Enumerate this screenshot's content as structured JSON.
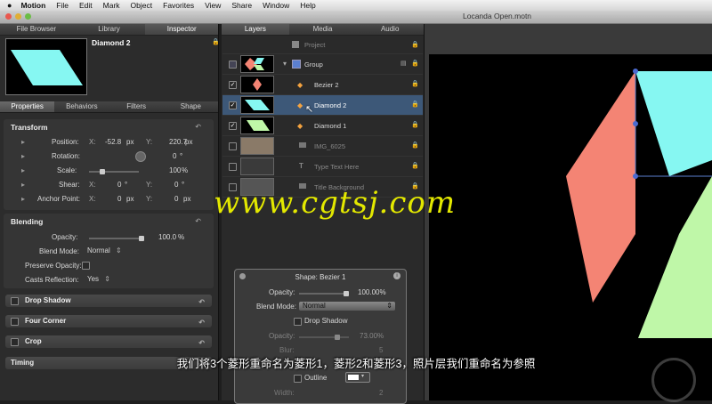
{
  "menubar": {
    "app": "Motion",
    "items": [
      "File",
      "Edit",
      "Mark",
      "Object",
      "Favorites",
      "View",
      "Share",
      "Window",
      "Help"
    ]
  },
  "window": {
    "title": "Locanda Open.motn"
  },
  "left_tabs": [
    "File Browser",
    "Library",
    "Inspector"
  ],
  "inspector": {
    "object_name": "Diamond 2",
    "sub_tabs": [
      "Properties",
      "Behaviors",
      "Filters",
      "Shape"
    ],
    "transform": {
      "title": "Transform",
      "position": {
        "label": "Position:",
        "x_label": "X:",
        "x": "-52.8",
        "x_unit": "px",
        "y_label": "Y:",
        "y": "220.7",
        "y_unit": "px"
      },
      "rotation": {
        "label": "Rotation:",
        "value": "0",
        "unit": "°"
      },
      "scale": {
        "label": "Scale:",
        "value": "100",
        "unit": "%"
      },
      "shear": {
        "label": "Shear:",
        "x_label": "X:",
        "x": "0",
        "x_unit": "°",
        "y_label": "Y:",
        "y": "0",
        "y_unit": "°"
      },
      "anchor": {
        "label": "Anchor Point:",
        "x_label": "X:",
        "x": "0",
        "x_unit": "px",
        "y_label": "Y:",
        "y": "0",
        "y_unit": "px"
      }
    },
    "blending": {
      "title": "Blending",
      "opacity": {
        "label": "Opacity:",
        "value": "100.0",
        "unit": "%"
      },
      "blend_mode": {
        "label": "Blend Mode:",
        "value": "Normal"
      },
      "preserve_opacity": {
        "label": "Preserve Opacity:"
      },
      "casts_reflection": {
        "label": "Casts Reflection:",
        "value": "Yes"
      }
    },
    "sections": [
      "Drop Shadow",
      "Four Corner",
      "Crop",
      "Timing"
    ]
  },
  "layers_tabs": [
    "Layers",
    "Media",
    "Audio"
  ],
  "layers": [
    {
      "name": "Project"
    },
    {
      "name": "Group"
    },
    {
      "name": "Bezier 2"
    },
    {
      "name": "Diamond 2"
    },
    {
      "name": "Diamond 1"
    },
    {
      "name": "IMG_6025"
    },
    {
      "name": "Type Text Here"
    },
    {
      "name": "Title Background"
    }
  ],
  "hud": {
    "title": "Shape: Bezier 1",
    "opacity": {
      "label": "Opacity:",
      "value": "100.00%"
    },
    "blend_mode": {
      "label": "Blend Mode:",
      "value": "Normal"
    },
    "drop_shadow": "Drop Shadow",
    "ds_opacity": {
      "label": "Opacity:",
      "value": "73.00%"
    },
    "blur": {
      "label": "Blur:",
      "value": "5"
    },
    "outline": "Outline",
    "width": {
      "label": "Width:",
      "value": "2"
    }
  },
  "watermark": "www.cgtsj.com",
  "subtitle": "我们将3个菱形重命名为菱形1，菱形2和菱形3，照片层我们重命名为参照",
  "colors": {
    "salmon": "#f48474",
    "cyan": "#86f7f2",
    "green": "#bff7a8",
    "selection": "#3d5878",
    "watermark": "#e3e800"
  }
}
